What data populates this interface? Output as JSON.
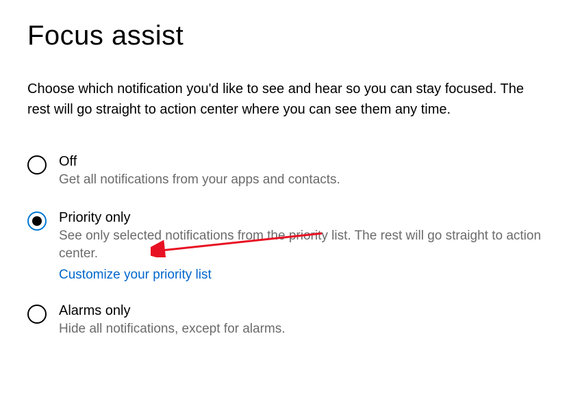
{
  "title": "Focus assist",
  "description": "Choose which notification you'd like to see and hear so you can stay focused. The rest will go straight to action center where you can see them any time.",
  "options": [
    {
      "label": "Off",
      "desc": "Get all notifications from your apps and contacts.",
      "selected": false
    },
    {
      "label": "Priority only",
      "desc": "See only selected notifications from the priority list. The rest will go straight to action center.",
      "link": "Customize your priority list",
      "selected": true
    },
    {
      "label": "Alarms only",
      "desc": "Hide all notifications, except for alarms.",
      "selected": false
    }
  ]
}
